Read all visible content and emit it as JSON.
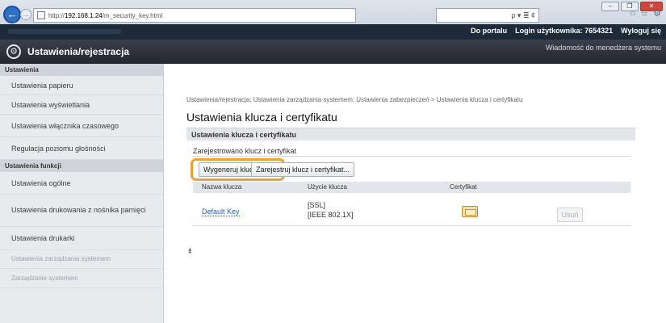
{
  "browser": {
    "url_prefix": "http://",
    "url_host": "192.168.1.24",
    "url_path": "/m_security_key.html",
    "search_label": "ρ ▾ ≣ ¢",
    "controls": [
      "‒",
      "❐",
      "✕"
    ]
  },
  "topbar": {
    "portal_link": "Do portalu",
    "login_label": "Login użytkownika:",
    "login_value": "7654321",
    "logout_link": "Wyloguj się"
  },
  "header": {
    "title": "Ustawienia/rejestracja",
    "admin_message": "Wiadomość do menedżera systemu"
  },
  "sidebar": {
    "section_settings": "Ustawienia",
    "items_settings": [
      "Ustawienia papieru",
      "Ustawienia wyświetlania",
      "Ustawienia włącznika czasowego",
      "Regulacja poziomu głośności"
    ],
    "section_functions": "Ustawienia funkcji",
    "item_general": "Ustawienia ogólne",
    "item_print_memory": "Ustawienia drukowania z nośnika pamięci",
    "item_printer": "Ustawienia drukarki",
    "item_system_mgmt": "Ustawienia zarządzania systemem",
    "item_system_mgmt2": "Zarządzanie systemem"
  },
  "main": {
    "breadcrumb": "Ustawienia/rejestracja: Ustawienia zarządzania systemem: Ustawienia zabezpieczeń > Ustawienia klucza i certyfikatu",
    "title": "Ustawienia klucza i certyfikatu",
    "section_title": "Ustawienia klucza i certyfikatu",
    "registered_label": "Zarejestrowano klucz i certyfikat",
    "btn_generate": "Wygeneruj klucz...",
    "btn_register": "Zarejestruj klucz i certyfikat...",
    "col_key_name": "Nazwa klucza",
    "col_key_usage": "Użycie klucza",
    "col_certificate": "Certyfikat",
    "row_key_name": "Default Key",
    "row_usage_1": "[SSL]",
    "row_usage_2": "[IEEE 802.1X]",
    "btn_delete": "Usuń",
    "top_arrow": "⯒"
  }
}
